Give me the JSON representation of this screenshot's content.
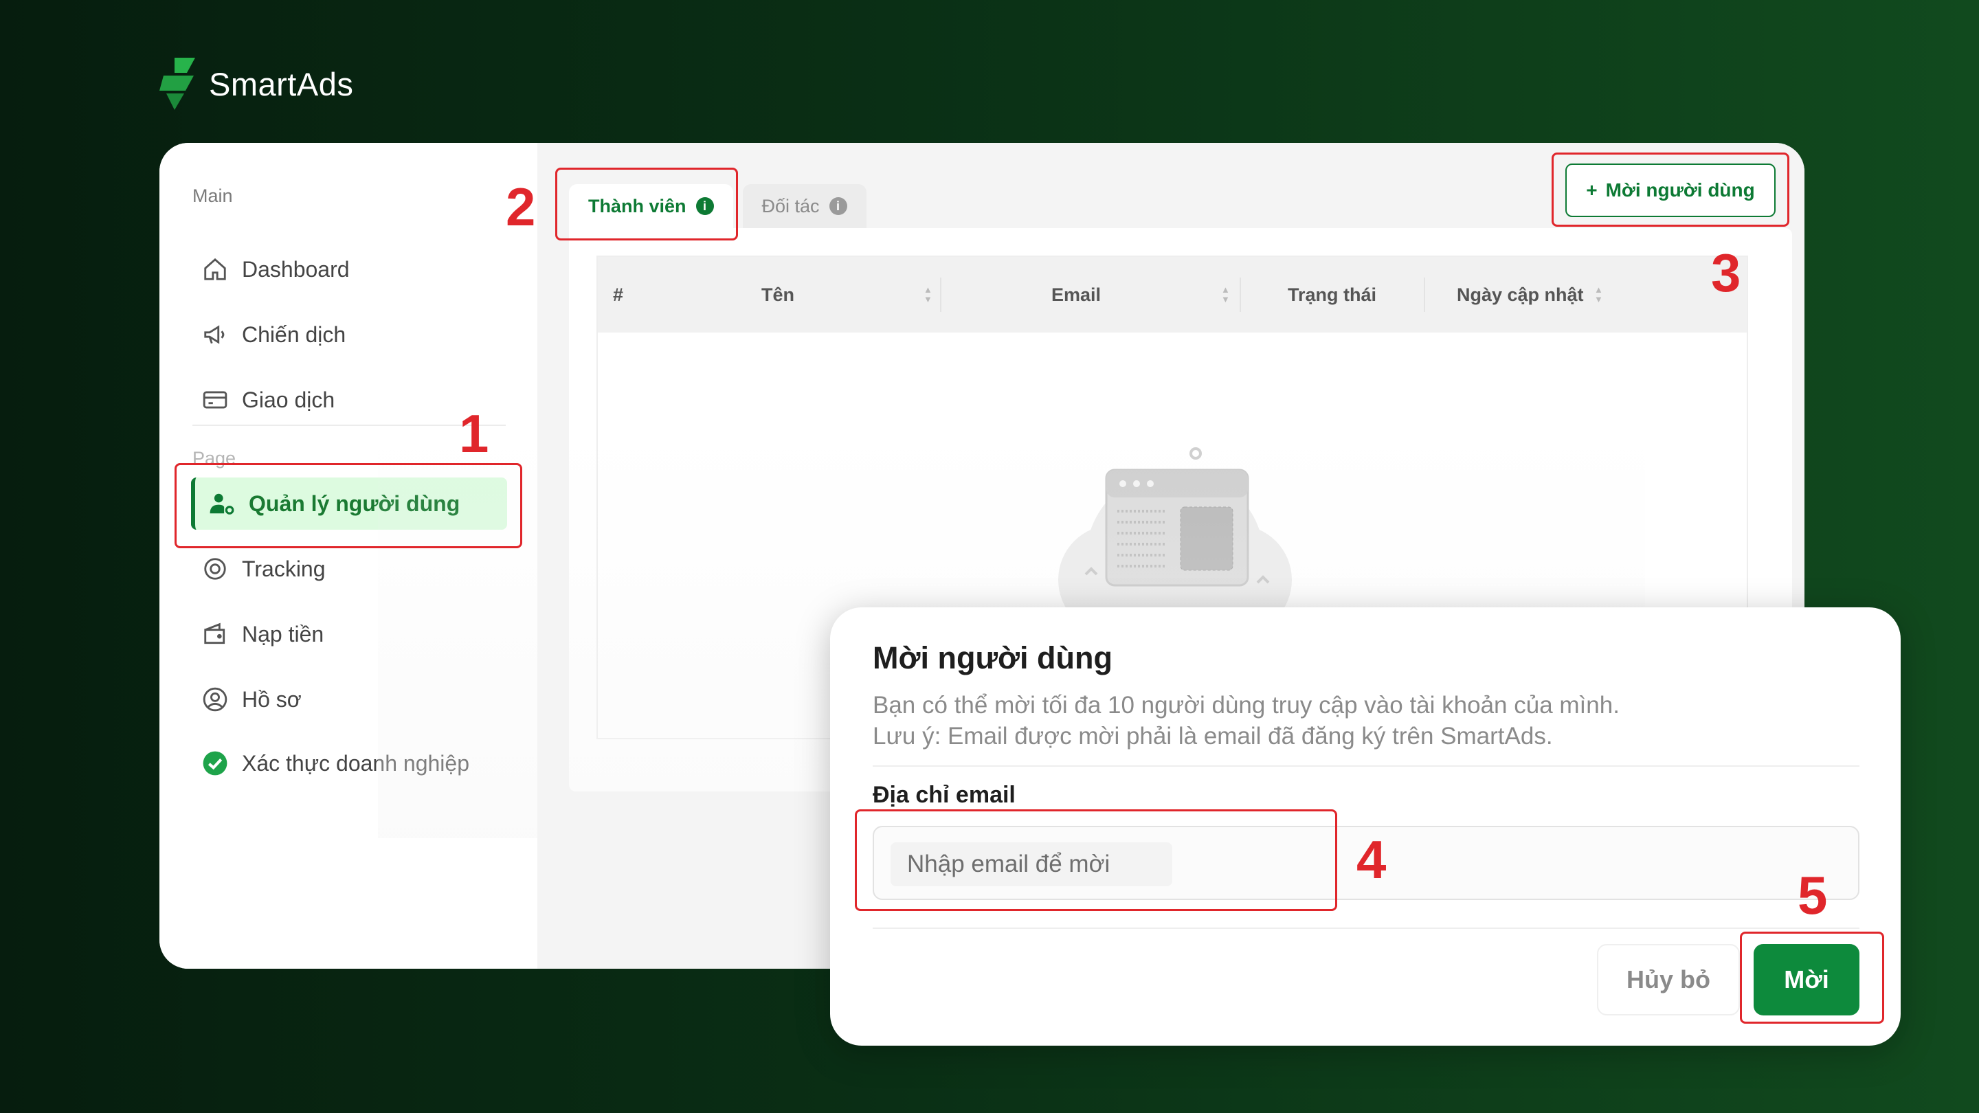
{
  "brand": {
    "name": "SmartAds"
  },
  "sidebar": {
    "sections": [
      {
        "title": "Main",
        "items": [
          {
            "label": "Dashboard",
            "icon": "home-icon"
          },
          {
            "label": "Chiến dịch",
            "icon": "megaphone-icon"
          },
          {
            "label": "Giao dịch",
            "icon": "card-icon"
          }
        ]
      },
      {
        "title": "Page",
        "items": [
          {
            "label": "Quản lý người dùng",
            "icon": "user-gear-icon",
            "active": true
          },
          {
            "label": "Tracking",
            "icon": "target-icon"
          },
          {
            "label": "Nạp tiền",
            "icon": "wallet-icon"
          },
          {
            "label": "Hồ sơ",
            "icon": "user-circle-icon"
          },
          {
            "label": "Xác thực doanh nghiệp",
            "icon": "verified-check-icon"
          }
        ]
      }
    ]
  },
  "tabs": [
    {
      "label": "Thành viên",
      "active": true
    },
    {
      "label": "Đối tác",
      "active": false
    }
  ],
  "toolbar": {
    "invite_label": "Mời người dùng",
    "invite_prefix": "+"
  },
  "table": {
    "columns": [
      "#",
      "Tên",
      "Email",
      "Trạng thái",
      "Ngày cập nhật"
    ]
  },
  "modal": {
    "title": "Mời người dùng",
    "desc_line1": "Bạn có thể mời tối đa 10 người dùng truy cập vào tài khoản của mình.",
    "desc_line2": "Lưu ý: Email được mời phải là email đã đăng ký trên SmartAds.",
    "email_label": "Địa chỉ email",
    "email_placeholder": "Nhập email để mời",
    "email_value": "",
    "cancel_label": "Hủy bỏ",
    "submit_label": "Mời"
  },
  "annotations": [
    "1",
    "2",
    "3",
    "4",
    "5"
  ],
  "colors": {
    "accent": "#0d8a3c",
    "highlight": "#e0262b",
    "active_bg": "#ddfbe0"
  }
}
